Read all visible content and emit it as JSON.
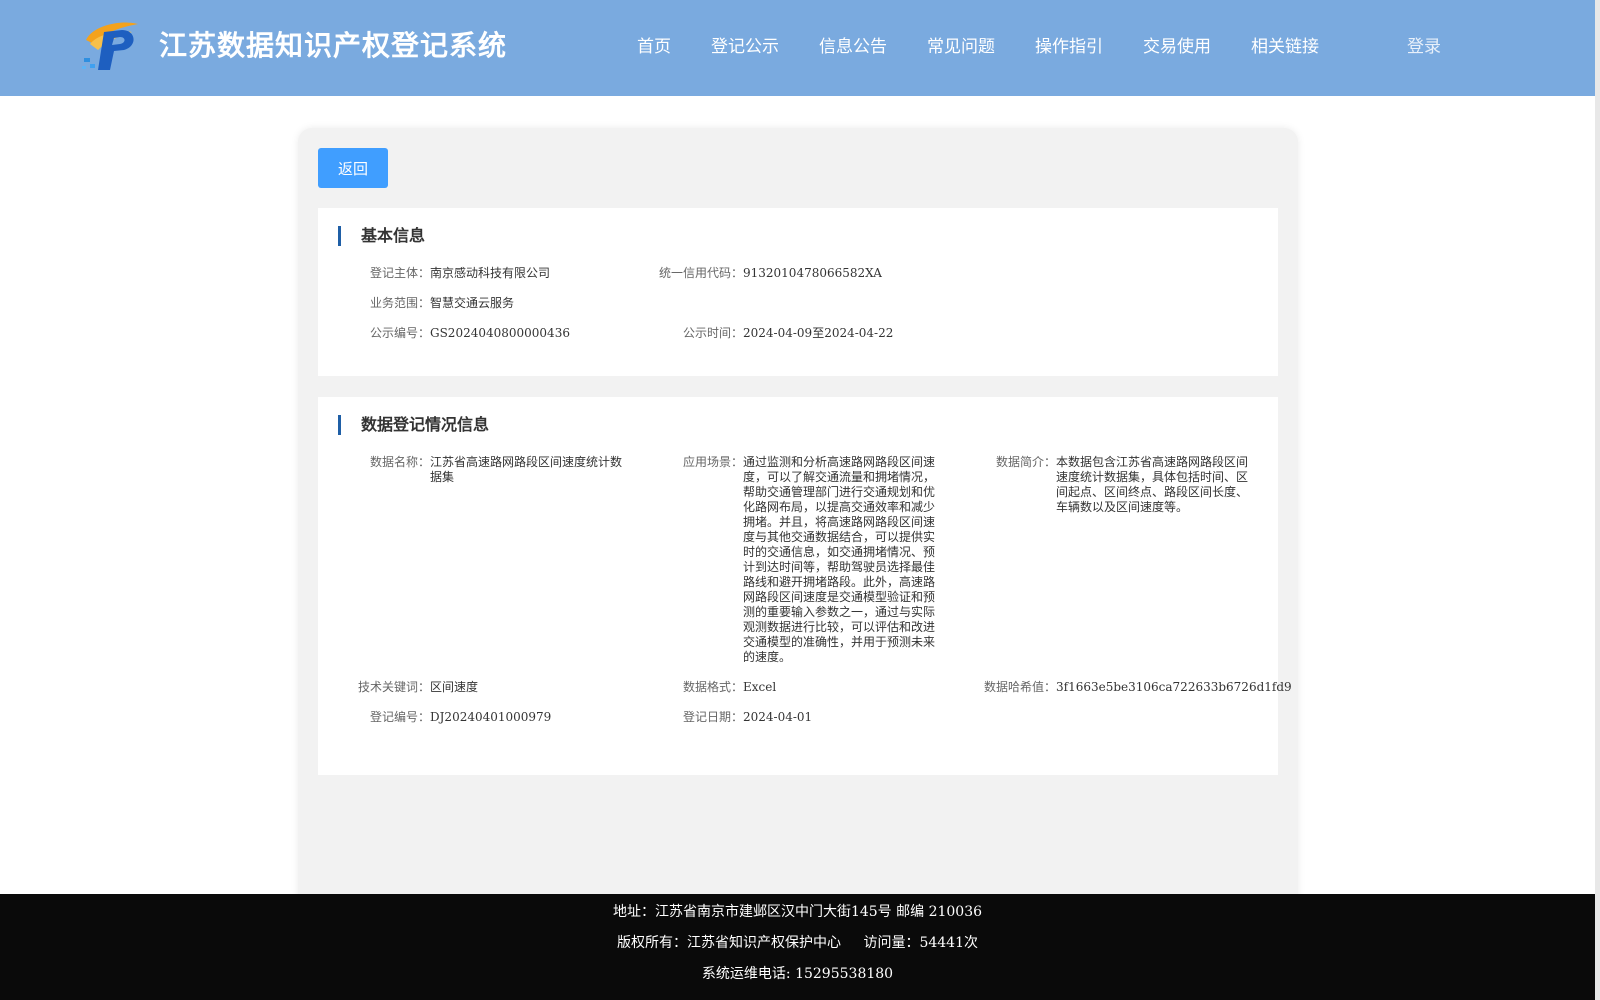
{
  "header": {
    "title": "江苏数据知识产权登记系统",
    "nav": [
      "首页",
      "登记公示",
      "信息公告",
      "常见问题",
      "操作指引",
      "交易使用",
      "相关链接"
    ],
    "login": "登录"
  },
  "back_button": "返回",
  "basic_info": {
    "title": "基本信息",
    "entity_label": "登记主体：",
    "entity": "南京感动科技有限公司",
    "credit_code_label": "统一信用代码：",
    "credit_code": "9132010478066582XA",
    "scope_label": "业务范围：",
    "scope": "智慧交通云服务",
    "notice_no_label": "公示编号：",
    "notice_no": "GS2024040800000436",
    "notice_time_label": "公示时间：",
    "notice_time": "2024-04-09至2024-04-22"
  },
  "data_info": {
    "title": "数据登记情况信息",
    "name_label": "数据名称：",
    "name": "江苏省高速路网路段区间速度统计数据集",
    "scenario_label": "应用场景：",
    "scenario": "通过监测和分析高速路网路段区间速度，可以了解交通流量和拥堵情况，帮助交通管理部门进行交通规划和优化路网布局，以提高交通效率和减少拥堵。并且，将高速路网路段区间速度与其他交通数据结合，可以提供实时的交通信息，如交通拥堵情况、预计到达时间等，帮助驾驶员选择最佳路线和避开拥堵路段。此外，高速路网路段区间速度是交通模型验证和预测的重要输入参数之一，通过与实际观测数据进行比较，可以评估和改进交通模型的准确性，并用于预测未来的速度。",
    "summary_label": "数据简介：",
    "summary": "本数据包含江苏省高速路网路段区间速度统计数据集，具体包括时间、区间起点、区间终点、路段区间长度、车辆数以及区间速度等。",
    "keywords_label": "技术关键词：",
    "keywords": "区间速度",
    "format_label": "数据格式：",
    "format": "Excel",
    "hash_label": "数据哈希值：",
    "hash": "3f1663e5be3106ca722633b6726d1fd9",
    "reg_no_label": "登记编号：",
    "reg_no": "DJ20240401000979",
    "reg_date_label": "登记日期：",
    "reg_date": "2024-04-01"
  },
  "footer": {
    "address": "地址：江苏省南京市建邺区汉中门大街145号 邮编 210036",
    "copyright": "版权所有：江苏省知识产权保护中心",
    "visits": "访问量：54441次",
    "phone": "系统运维电话: 15295538180"
  },
  "colors": {
    "header_bg": "#7aaadf",
    "button_bg": "#409eff",
    "section_accent": "#1f5fa6",
    "footer_bg": "#0a0a0a"
  }
}
